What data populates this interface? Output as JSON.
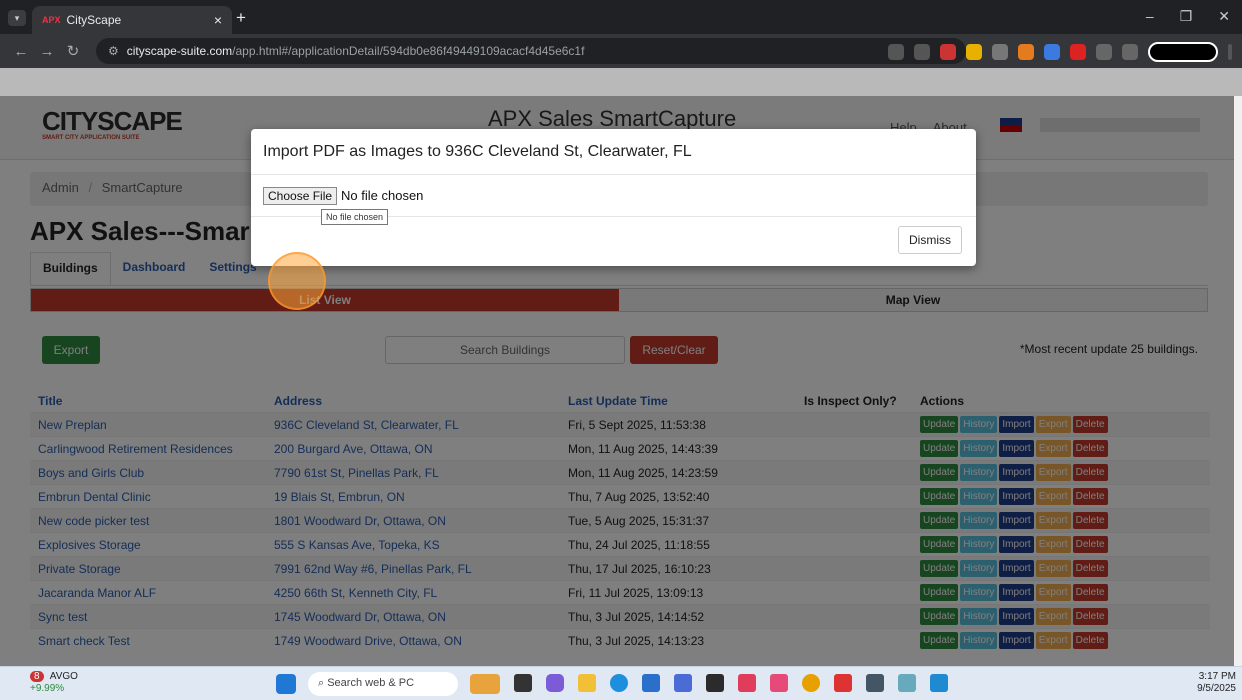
{
  "browser": {
    "tab_title": "CityScape",
    "tab_favicon": "APX",
    "url_host": "cityscape-suite.com",
    "url_path": "/app.html#/applicationDetail/594db0e86f49449109acacf4d45e6c1f"
  },
  "app": {
    "logo": "CITYSCAPE",
    "logo_sub": "SMART CITY APPLICATION SUITE",
    "title": "APX Sales SmartCapture",
    "help": "Help",
    "about": "About"
  },
  "breadcrumb": {
    "root": "Admin",
    "sep": "/",
    "current": "SmartCapture"
  },
  "page_title": "APX Sales---Smar",
  "tabs": [
    "Buildings",
    "Dashboard",
    "Settings"
  ],
  "views": {
    "list": "List View",
    "map": "Map View"
  },
  "toolbar": {
    "export": "Export",
    "search_placeholder": "Search Buildings",
    "reset": "Reset/Clear",
    "note": "*Most recent update 25 buildings."
  },
  "table": {
    "headers": [
      "Title",
      "Address",
      "Last Update Time",
      "Is Inspect Only?",
      "Actions"
    ],
    "actions": [
      "Update",
      "History",
      "Import",
      "Export",
      "Delete"
    ],
    "rows": [
      {
        "title": "New Preplan",
        "address": "936C Cleveland St, Clearwater, FL",
        "time": "Fri, 5 Sept 2025, 11:53:38"
      },
      {
        "title": "Carlingwood Retirement Residences",
        "address": "200 Burgard Ave, Ottawa, ON",
        "time": "Mon, 11 Aug 2025, 14:43:39"
      },
      {
        "title": "Boys and Girls Club",
        "address": "7790 61st St, Pinellas Park, FL",
        "time": "Mon, 11 Aug 2025, 14:23:59"
      },
      {
        "title": "Embrun Dental Clinic",
        "address": "19 Blais St, Embrun, ON",
        "time": "Thu, 7 Aug 2025, 13:52:40"
      },
      {
        "title": "New code picker test",
        "address": "1801 Woodward Dr, Ottawa, ON",
        "time": "Tue, 5 Aug 2025, 15:31:37"
      },
      {
        "title": "Explosives Storage",
        "address": "555 S Kansas Ave, Topeka, KS",
        "time": "Thu, 24 Jul 2025, 11:18:55"
      },
      {
        "title": "Private Storage",
        "address": "7991 62nd Way #6, Pinellas Park, FL",
        "time": "Thu, 17 Jul 2025, 16:10:23"
      },
      {
        "title": "Jacaranda Manor ALF",
        "address": "4250 66th St, Kenneth City, FL",
        "time": "Fri, 11 Jul 2025, 13:09:13"
      },
      {
        "title": "Sync test",
        "address": "1745 Woodward Dr, Ottawa, ON",
        "time": "Thu, 3 Jul 2025, 14:14:52"
      },
      {
        "title": "Smart check Test",
        "address": "1749 Woodward Drive, Ottawa, ON",
        "time": "Thu, 3 Jul 2025, 14:13:23"
      }
    ]
  },
  "modal": {
    "title": "Import PDF as Images to 936C Cleveland St, Clearwater, FL",
    "choose": "Choose File",
    "no_file": "No file chosen",
    "tooltip": "No file chosen",
    "dismiss": "Dismiss"
  },
  "taskbar": {
    "stock_name": "AVGO",
    "stock_change": "+9.99%",
    "notif": "8",
    "search": "Search web & PC",
    "time": "3:17 PM",
    "date": "9/5/2025"
  }
}
